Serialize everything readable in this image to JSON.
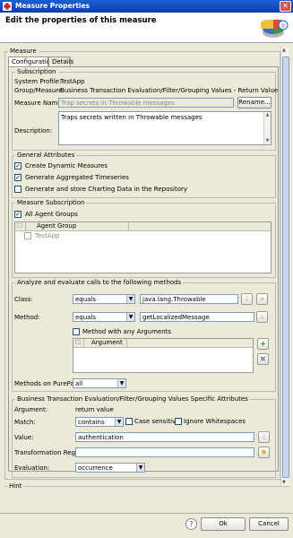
{
  "window": {
    "title": "Measure Properties"
  },
  "header": {
    "title": "Edit the properties of this measure"
  },
  "measure_group": {
    "legend": "Measure"
  },
  "tabs": [
    {
      "label": "Configuration"
    },
    {
      "label": "Details"
    }
  ],
  "subscription": {
    "legend": "Subscription",
    "system_profile_label": "System Profile:",
    "system_profile_value": "TestApp",
    "group_measure_label": "Group/Measure:",
    "group_measure_value": "Business Transaction Evaluation/Filter/Grouping Values - Return Value",
    "measure_name_label": "Measure Name:",
    "measure_name_placeholder": "Trap secrets in Throwable messages",
    "rename_label": "Rename...",
    "description_label": "Description:",
    "description_value": "Traps secrets written in Throwable messages"
  },
  "general_attributes": {
    "legend": "General Attributes",
    "options": [
      {
        "label": "Create Dynamic Measures",
        "checked": true
      },
      {
        "label": "Generate Aggregated Timeseries",
        "checked": true
      },
      {
        "label": "Generate and store Charting Data in the Repository",
        "checked": false
      }
    ]
  },
  "measure_subscription": {
    "legend": "Measure Subscription",
    "all_agent_groups_label": "All Agent Groups",
    "all_agent_groups_checked": true,
    "table": {
      "column": "Agent Group",
      "rows": [
        "TestApp"
      ]
    }
  },
  "analyze": {
    "legend": "Analyze and evaluate calls to the following methods",
    "class_label": "Class:",
    "class_operator": "equals",
    "class_value": "java.lang.Throwable",
    "method_label": "Method:",
    "method_operator": "equals",
    "method_value": "getLocalizedMessage",
    "any_arguments_label": "Method with any Arguments",
    "argument_column": "Argument",
    "methods_on_purepath_label": "Methods on PurePath:",
    "methods_on_purepath_value": "all"
  },
  "bt_attributes": {
    "legend": "Business Transaction Evaluation/Filter/Grouping Values Specific Attributes",
    "argument_label": "Argument:",
    "argument_value": "return value",
    "match_label": "Match:",
    "match_value": "contains",
    "case_sensitive_label": "Case sensitive",
    "ignore_whitespaces_label": "Ignore Whitespaces",
    "value_label": "Value:",
    "value_value": "authentication",
    "transformation_label": "Transformation Regex:",
    "transformation_value": "",
    "evaluation_label": "Evaluation:",
    "evaluation_value": "occurrence"
  },
  "hint": {
    "legend": "Hint"
  },
  "footer": {
    "help_icon": "?",
    "ok_label": "Ok",
    "cancel_label": "Cancel"
  }
}
